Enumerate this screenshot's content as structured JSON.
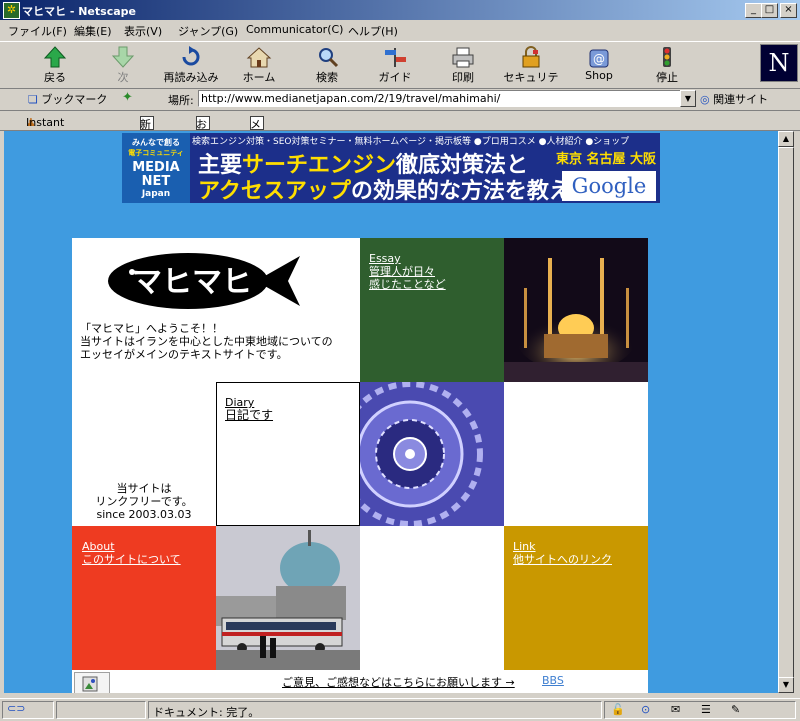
{
  "window": {
    "title": "マヒマヒ - Netscape"
  },
  "menu": [
    "ファイル(F)",
    "編集(E)",
    "表示(V)",
    "ジャンプ(G)",
    "Communicator(C)",
    "ヘルプ(H)"
  ],
  "toolbar": {
    "back": "戻る",
    "forward": "次",
    "reload": "再読み込み",
    "home": "ホーム",
    "search": "検索",
    "guide": "ガイド",
    "print": "印刷",
    "security": "セキュリティ",
    "shop": "Shop",
    "stop": "停止"
  },
  "location": {
    "bookmarks_label": "ブックマーク",
    "location_label": "場所:",
    "url": "http://www.medianetjapan.com/2/19/travel/mahimahi/",
    "related_label": "関連サイト"
  },
  "personal": {
    "instant_message": "Instant Message",
    "new": "新着",
    "recommend": "お勧め",
    "members": "メンバーズ"
  },
  "banner": {
    "badge_top": "みんなで創る",
    "badge_mid": "電子コミュニティ",
    "badge_name": "MEDIA NET",
    "badge_sub": "Japan",
    "top_links": "検索エンジン対策・SEO対策セミナー・無料ホームページ・掲示板等 ●プロ用コスメ ●人材紹介 ●ショップ",
    "line1_a": "主要",
    "line1_b": "サーチエンジン",
    "line1_c": "徹底対策法と",
    "line2_a": "アクセスアップ",
    "line2_b": "の効果的な方法を教えます。",
    "cities": "東京  名古屋  大阪",
    "google": "Google"
  },
  "site": {
    "logo_text": "マヒマヒ",
    "welcome_1": "「マヒマヒ」へようこそ！！",
    "welcome_2": "当サイトはイランを中心とした中東地域についての",
    "welcome_3": "エッセイがメインのテキストサイトです。",
    "essay_title": "Essay",
    "essay_l1": "管理人が日々",
    "essay_l2": "感じたことなど",
    "diary_title": "Diary",
    "diary_desc": "日記です",
    "linkfree_1": "当サイトは",
    "linkfree_2": "リンクフリーです。",
    "since": "since 2003.03.03",
    "about_title": "About",
    "about_desc": "このサイトについて",
    "link_title": "Link",
    "link_desc": "他サイトへのリンク",
    "feedback_text": "ご意見、ご感想などはこちらにお願いします →",
    "bbs": "BBS"
  },
  "status": {
    "text": "ドキュメント: 完了。"
  },
  "colors": {
    "page_bg": "#3f9be0",
    "essay_bg": "#2f5e2e",
    "about_bg": "#ee3b21",
    "link_bg": "#c99800",
    "chrome": "#d4d0c8"
  }
}
